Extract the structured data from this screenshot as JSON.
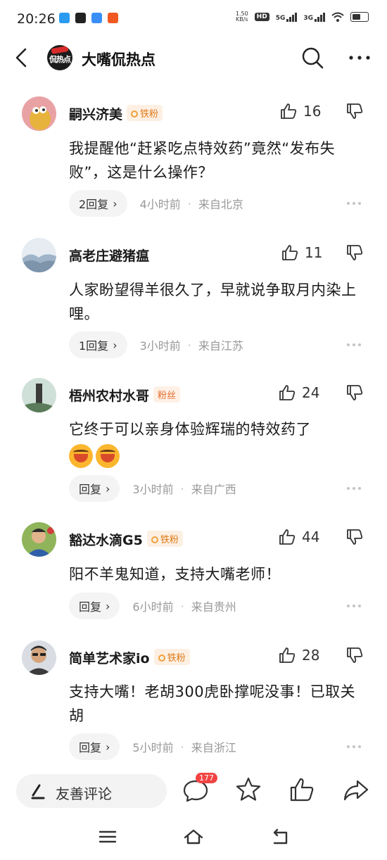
{
  "status_bar": {
    "time": "20:26",
    "net_speed_value": "1.50",
    "net_speed_unit": "KB/s",
    "hd": "HD",
    "net1": "5G",
    "net2": "3G"
  },
  "header": {
    "title": "大嘴侃热点",
    "logo_text": "侃热点"
  },
  "comments": [
    {
      "user": "嗣兴济美",
      "badge": "铁粉",
      "likes": "16",
      "text": "我提醒他“赶紧吃点特效药”竟然“发布失败”，这是什么操作？",
      "reply_label": "2回复",
      "time": "4小时前",
      "location": "来自北京"
    },
    {
      "user": "高老庄避猪瘟",
      "badge": "",
      "likes": "11",
      "text": "人家盼望得羊很久了，早就说争取月内染上哩。",
      "reply_label": "1回复",
      "time": "3小时前",
      "location": "来自江苏"
    },
    {
      "user": "梧州农村水哥",
      "badge": "粉丝",
      "likes": "24",
      "text": "它终于可以亲身体验辉瑞的特效药了",
      "reply_label": "回复",
      "time": "3小时前",
      "location": "来自广西"
    },
    {
      "user": "豁达水滴G5",
      "badge": "铁粉",
      "likes": "44",
      "text": "阳不羊鬼知道，支持大嘴老师！",
      "reply_label": "回复",
      "time": "6小时前",
      "location": "来自贵州"
    },
    {
      "user": "简单艺术家io",
      "badge": "铁粉",
      "likes": "28",
      "text": "支持大嘴！老胡300虎卧撑呢没事！已取关胡",
      "reply_label": "回复",
      "time": "5小时前",
      "location": "来自浙江"
    }
  ],
  "bottom_bar": {
    "placeholder": "友善评论",
    "comment_count": "177"
  },
  "separator": "·"
}
